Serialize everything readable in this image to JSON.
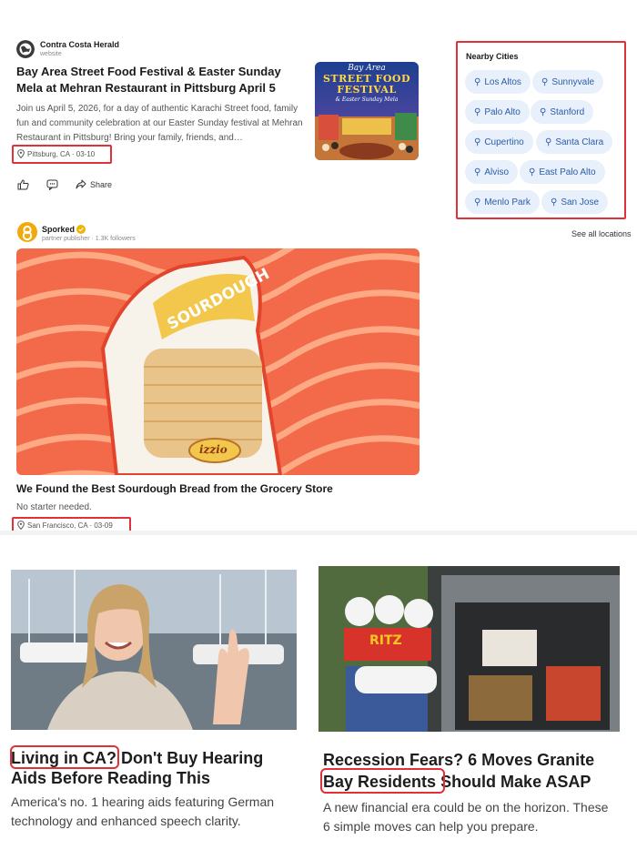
{
  "article1": {
    "publisher": "Contra Costa Herald",
    "publisher_type": "website",
    "headline": "Bay Area Street Food Festival & Easter Sunday Mela at Mehran Restaurant in Pittsburg April 5",
    "snippet": "Join us April 5, 2026, for a day of authentic Karachi Street food, family fun and community celebration at our Easter Sunday festival at Mehran Restaurant in Pittsburg! Bring your family, friends, and…",
    "location": "Pittsburg, CA · 03-10",
    "thumb_line1": "Bay Area",
    "thumb_line2": "STREET FOOD",
    "thumb_line3": "FESTIVAL",
    "thumb_line4": "& Easter Sunday Mela",
    "share_label": "Share"
  },
  "nearby": {
    "title": "Nearby Cities",
    "cities": [
      "Los Altos",
      "Sunnyvale",
      "Palo Alto",
      "Stanford",
      "Cupertino",
      "Santa Clara",
      "Alviso",
      "East Palo Alto",
      "Menlo Park",
      "San Jose"
    ],
    "see_all": "See all locations"
  },
  "article2": {
    "publisher": "Sporked",
    "publisher_sub": "partner publisher · 1.3K followers",
    "headline": "We Found the Best Sourdough Bread from the Grocery Store",
    "snippet": "No starter needed.",
    "location": "San Francisco, CA · 03-09",
    "bag_text": "SOURDOUGH",
    "brand": "izzio"
  },
  "ads": [
    {
      "title_hl": "Living in CA?",
      "title_rest": " Don't Buy Hearing Aids Before Reading This",
      "desc": "America's no. 1 hearing aids featuring German technology and enhanced speech clarity."
    },
    {
      "title_pre": "Recession Fears? 6 Moves Granite",
      "title_hl": "Bay Residents",
      "title_rest": " Should Make ASAP",
      "desc": "A new financial era could be on the horizon. These 6 simple moves can help you prepare.",
      "box_text": "RITZ"
    }
  ],
  "colors": {
    "highlight_border": "#e0303a",
    "chip_bg": "#e8f0fb",
    "chip_text": "#2b5caa",
    "sporked_logo": "#f2a90c",
    "verified": "#f0b400"
  }
}
